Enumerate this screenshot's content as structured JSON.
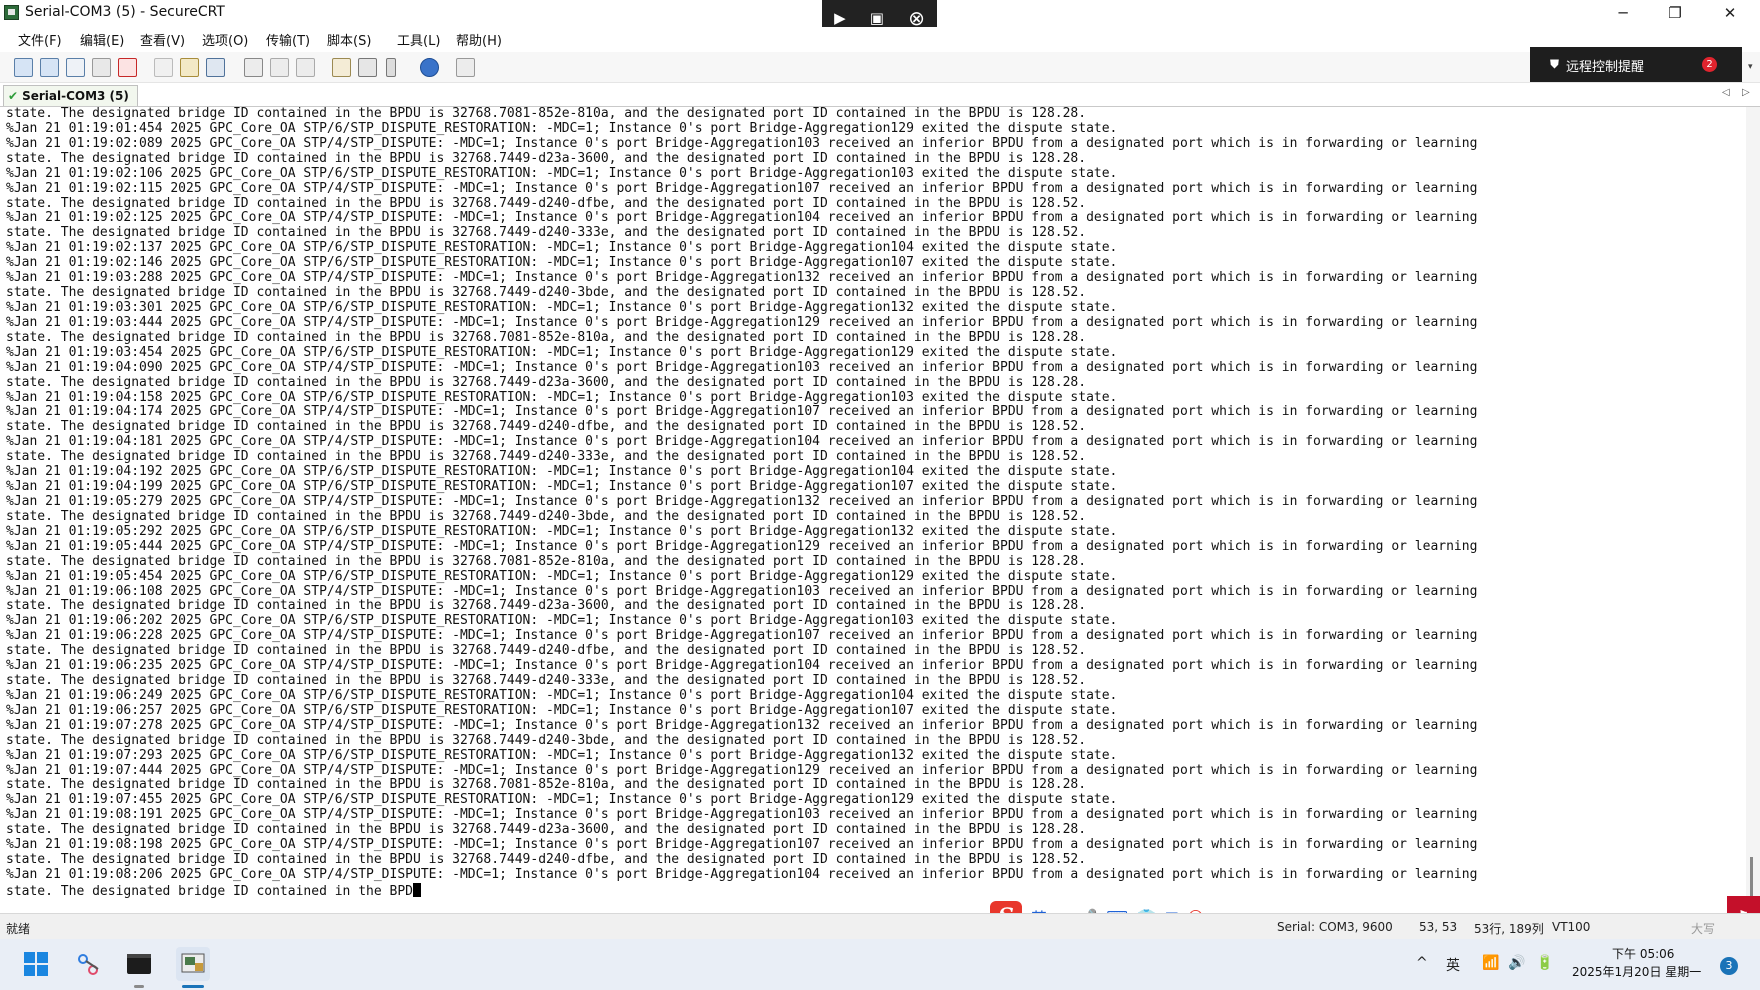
{
  "window": {
    "title": "Serial-COM3 (5) - SecureCRT",
    "minimize_glyph": "─",
    "maximize_glyph": "❐",
    "close_glyph": "✕"
  },
  "remote_control": {
    "icons": [
      "play-icon",
      "screen-icon",
      "close-circle-icon"
    ],
    "play_glyph": "▶",
    "screen_glyph": "▣",
    "close_glyph": "⊗"
  },
  "menu": {
    "items": [
      "文件(F)",
      "编辑(E)",
      "查看(V)",
      "选项(O)",
      "传输(T)",
      "脚本(S)",
      "工具(L)",
      "帮助(H)"
    ]
  },
  "toolbar": {
    "icons": [
      "connect-icon",
      "quick-connect-icon",
      "connect-tab-icon",
      "reconnect-icon",
      "disconnect-icon",
      "copy-icon",
      "paste-icon",
      "find-icon",
      "print-icon",
      "print-selection-icon",
      "printer-icon",
      "session-options-icon",
      "global-options-icon",
      "keymap-icon",
      "help-icon",
      "script-icon"
    ],
    "reminder_label": "远程控制提醒",
    "reminder_badge": "2",
    "scroll_glyph": "▾"
  },
  "tabs": {
    "active": "Serial-COM3 (5)",
    "check_glyph": "✔",
    "left_arrow": "◁",
    "right_arrow": "▷"
  },
  "terminal": {
    "lines": [
      "state. The designated bridge ID contained in the BPDU is 32768.7081-852e-810a, and the designated port ID contained in the BPDU is 128.28.",
      "%Jan 21 01:19:01:454 2025 GPC_Core_OA STP/6/STP_DISPUTE_RESTORATION: -MDC=1; Instance 0's port Bridge-Aggregation129 exited the dispute state.",
      "%Jan 21 01:19:02:089 2025 GPC_Core_OA STP/4/STP_DISPUTE: -MDC=1; Instance 0's port Bridge-Aggregation103 received an inferior BPDU from a designated port which is in forwarding or learning",
      "state. The designated bridge ID contained in the BPDU is 32768.7449-d23a-3600, and the designated port ID contained in the BPDU is 128.28.",
      "%Jan 21 01:19:02:106 2025 GPC_Core_OA STP/6/STP_DISPUTE_RESTORATION: -MDC=1; Instance 0's port Bridge-Aggregation103 exited the dispute state.",
      "%Jan 21 01:19:02:115 2025 GPC_Core_OA STP/4/STP_DISPUTE: -MDC=1; Instance 0's port Bridge-Aggregation107 received an inferior BPDU from a designated port which is in forwarding or learning",
      "state. The designated bridge ID contained in the BPDU is 32768.7449-d240-dfbe, and the designated port ID contained in the BPDU is 128.52.",
      "%Jan 21 01:19:02:125 2025 GPC_Core_OA STP/4/STP_DISPUTE: -MDC=1; Instance 0's port Bridge-Aggregation104 received an inferior BPDU from a designated port which is in forwarding or learning",
      "state. The designated bridge ID contained in the BPDU is 32768.7449-d240-333e, and the designated port ID contained in the BPDU is 128.52.",
      "%Jan 21 01:19:02:137 2025 GPC_Core_OA STP/6/STP_DISPUTE_RESTORATION: -MDC=1; Instance 0's port Bridge-Aggregation104 exited the dispute state.",
      "%Jan 21 01:19:02:146 2025 GPC_Core_OA STP/6/STP_DISPUTE_RESTORATION: -MDC=1; Instance 0's port Bridge-Aggregation107 exited the dispute state.",
      "%Jan 21 01:19:03:288 2025 GPC_Core_OA STP/4/STP_DISPUTE: -MDC=1; Instance 0's port Bridge-Aggregation132 received an inferior BPDU from a designated port which is in forwarding or learning",
      "state. The designated bridge ID contained in the BPDU is 32768.7449-d240-3bde, and the designated port ID contained in the BPDU is 128.52.",
      "%Jan 21 01:19:03:301 2025 GPC_Core_OA STP/6/STP_DISPUTE_RESTORATION: -MDC=1; Instance 0's port Bridge-Aggregation132 exited the dispute state.",
      "%Jan 21 01:19:03:444 2025 GPC_Core_OA STP/4/STP_DISPUTE: -MDC=1; Instance 0's port Bridge-Aggregation129 received an inferior BPDU from a designated port which is in forwarding or learning",
      "state. The designated bridge ID contained in the BPDU is 32768.7081-852e-810a, and the designated port ID contained in the BPDU is 128.28.",
      "%Jan 21 01:19:03:454 2025 GPC_Core_OA STP/6/STP_DISPUTE_RESTORATION: -MDC=1; Instance 0's port Bridge-Aggregation129 exited the dispute state.",
      "%Jan 21 01:19:04:090 2025 GPC_Core_OA STP/4/STP_DISPUTE: -MDC=1; Instance 0's port Bridge-Aggregation103 received an inferior BPDU from a designated port which is in forwarding or learning",
      "state. The designated bridge ID contained in the BPDU is 32768.7449-d23a-3600, and the designated port ID contained in the BPDU is 128.28.",
      "%Jan 21 01:19:04:158 2025 GPC_Core_OA STP/6/STP_DISPUTE_RESTORATION: -MDC=1; Instance 0's port Bridge-Aggregation103 exited the dispute state.",
      "%Jan 21 01:19:04:174 2025 GPC_Core_OA STP/4/STP_DISPUTE: -MDC=1; Instance 0's port Bridge-Aggregation107 received an inferior BPDU from a designated port which is in forwarding or learning",
      "state. The designated bridge ID contained in the BPDU is 32768.7449-d240-dfbe, and the designated port ID contained in the BPDU is 128.52.",
      "%Jan 21 01:19:04:181 2025 GPC_Core_OA STP/4/STP_DISPUTE: -MDC=1; Instance 0's port Bridge-Aggregation104 received an inferior BPDU from a designated port which is in forwarding or learning",
      "state. The designated bridge ID contained in the BPDU is 32768.7449-d240-333e, and the designated port ID contained in the BPDU is 128.52.",
      "%Jan 21 01:19:04:192 2025 GPC_Core_OA STP/6/STP_DISPUTE_RESTORATION: -MDC=1; Instance 0's port Bridge-Aggregation104 exited the dispute state.",
      "%Jan 21 01:19:04:199 2025 GPC_Core_OA STP/6/STP_DISPUTE_RESTORATION: -MDC=1; Instance 0's port Bridge-Aggregation107 exited the dispute state.",
      "%Jan 21 01:19:05:279 2025 GPC_Core_OA STP/4/STP_DISPUTE: -MDC=1; Instance 0's port Bridge-Aggregation132 received an inferior BPDU from a designated port which is in forwarding or learning",
      "state. The designated bridge ID contained in the BPDU is 32768.7449-d240-3bde, and the designated port ID contained in the BPDU is 128.52.",
      "%Jan 21 01:19:05:292 2025 GPC_Core_OA STP/6/STP_DISPUTE_RESTORATION: -MDC=1; Instance 0's port Bridge-Aggregation132 exited the dispute state.",
      "%Jan 21 01:19:05:444 2025 GPC_Core_OA STP/4/STP_DISPUTE: -MDC=1; Instance 0's port Bridge-Aggregation129 received an inferior BPDU from a designated port which is in forwarding or learning",
      "state. The designated bridge ID contained in the BPDU is 32768.7081-852e-810a, and the designated port ID contained in the BPDU is 128.28.",
      "%Jan 21 01:19:05:454 2025 GPC_Core_OA STP/6/STP_DISPUTE_RESTORATION: -MDC=1; Instance 0's port Bridge-Aggregation129 exited the dispute state.",
      "%Jan 21 01:19:06:108 2025 GPC_Core_OA STP/4/STP_DISPUTE: -MDC=1; Instance 0's port Bridge-Aggregation103 received an inferior BPDU from a designated port which is in forwarding or learning",
      "state. The designated bridge ID contained in the BPDU is 32768.7449-d23a-3600, and the designated port ID contained in the BPDU is 128.28.",
      "%Jan 21 01:19:06:202 2025 GPC_Core_OA STP/6/STP_DISPUTE_RESTORATION: -MDC=1; Instance 0's port Bridge-Aggregation103 exited the dispute state.",
      "%Jan 21 01:19:06:228 2025 GPC_Core_OA STP/4/STP_DISPUTE: -MDC=1; Instance 0's port Bridge-Aggregation107 received an inferior BPDU from a designated port which is in forwarding or learning",
      "state. The designated bridge ID contained in the BPDU is 32768.7449-d240-dfbe, and the designated port ID contained in the BPDU is 128.52.",
      "%Jan 21 01:19:06:235 2025 GPC_Core_OA STP/4/STP_DISPUTE: -MDC=1; Instance 0's port Bridge-Aggregation104 received an inferior BPDU from a designated port which is in forwarding or learning",
      "state. The designated bridge ID contained in the BPDU is 32768.7449-d240-333e, and the designated port ID contained in the BPDU is 128.52.",
      "%Jan 21 01:19:06:249 2025 GPC_Core_OA STP/6/STP_DISPUTE_RESTORATION: -MDC=1; Instance 0's port Bridge-Aggregation104 exited the dispute state.",
      "%Jan 21 01:19:06:257 2025 GPC_Core_OA STP/6/STP_DISPUTE_RESTORATION: -MDC=1; Instance 0's port Bridge-Aggregation107 exited the dispute state.",
      "%Jan 21 01:19:07:278 2025 GPC_Core_OA STP/4/STP_DISPUTE: -MDC=1; Instance 0's port Bridge-Aggregation132 received an inferior BPDU from a designated port which is in forwarding or learning",
      "state. The designated bridge ID contained in the BPDU is 32768.7449-d240-3bde, and the designated port ID contained in the BPDU is 128.52.",
      "%Jan 21 01:19:07:293 2025 GPC_Core_OA STP/6/STP_DISPUTE_RESTORATION: -MDC=1; Instance 0's port Bridge-Aggregation132 exited the dispute state.",
      "%Jan 21 01:19:07:444 2025 GPC_Core_OA STP/4/STP_DISPUTE: -MDC=1; Instance 0's port Bridge-Aggregation129 received an inferior BPDU from a designated port which is in forwarding or learning",
      "state. The designated bridge ID contained in the BPDU is 32768.7081-852e-810a, and the designated port ID contained in the BPDU is 128.28.",
      "%Jan 21 01:19:07:455 2025 GPC_Core_OA STP/6/STP_DISPUTE_RESTORATION: -MDC=1; Instance 0's port Bridge-Aggregation129 exited the dispute state.",
      "%Jan 21 01:19:08:191 2025 GPC_Core_OA STP/4/STP_DISPUTE: -MDC=1; Instance 0's port Bridge-Aggregation103 received an inferior BPDU from a designated port which is in forwarding or learning",
      "state. The designated bridge ID contained in the BPDU is 32768.7449-d23a-3600, and the designated port ID contained in the BPDU is 128.28.",
      "%Jan 21 01:19:08:198 2025 GPC_Core_OA STP/4/STP_DISPUTE: -MDC=1; Instance 0's port Bridge-Aggregation107 received an inferior BPDU from a designated port which is in forwarding or learning",
      "state. The designated bridge ID contained in the BPDU is 32768.7449-d240-dfbe, and the designated port ID contained in the BPDU is 128.52.",
      "%Jan 21 01:19:08:206 2025 GPC_Core_OA STP/4/STP_DISPUTE: -MDC=1; Instance 0's port Bridge-Aggregation104 received an inferior BPDU from a designated port which is in forwarding or learning"
    ],
    "current_line": "state. The designated bridge ID contained in the BPD"
  },
  "statusbar": {
    "ready": "就绪",
    "connection": "Serial: COM3, 9600",
    "cursor_pos": "53,  53",
    "rows_cols": "53行, 189列",
    "emulation": "VT100",
    "caps": "大写"
  },
  "ime": {
    "logo": "S",
    "lang": "英",
    "punct": "•,",
    "mic": "🎤",
    "keyboard": "⌨",
    "skin": "👕",
    "apps": "▦",
    "emoji": "☺"
  },
  "taskbar": {
    "icons": [
      "windows-start-icon",
      "snipping-tool-icon",
      "terminal-icon",
      "securecrt-icon"
    ],
    "tray": {
      "chevron": "^",
      "ime": "英",
      "wifi": "📶",
      "volume": "🔊",
      "battery": "🔋",
      "time": "下午 05:06",
      "date": "2025年1月20日 星期一",
      "notifications": "3"
    }
  },
  "colors": {
    "accent": "#1a73b8",
    "reminder_bg": "#1e1e1e",
    "badge": "#e0242e",
    "ime_red": "#e8372c"
  }
}
